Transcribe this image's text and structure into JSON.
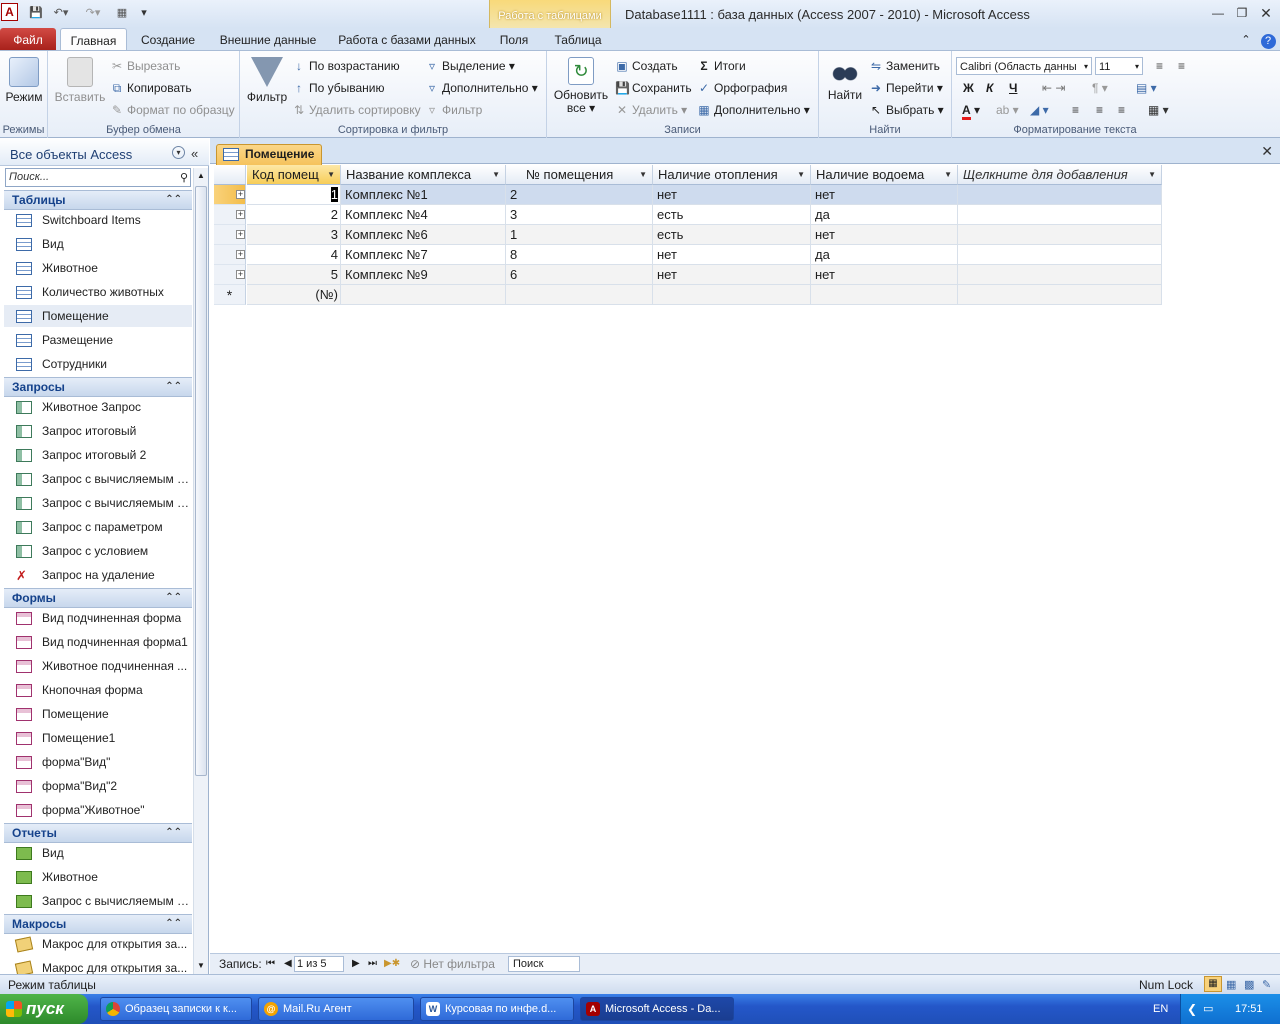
{
  "window": {
    "title": "Database1111 : база данных (Access 2007 - 2010)  -  Microsoft Access",
    "app_logo": "A",
    "contextual_group": "Работа с таблицами"
  },
  "tabs": [
    {
      "label": "Файл"
    },
    {
      "label": "Главная"
    },
    {
      "label": "Создание"
    },
    {
      "label": "Внешние данные"
    },
    {
      "label": "Работа с базами данных"
    },
    {
      "label": "Поля"
    },
    {
      "label": "Таблица"
    }
  ],
  "ribbon": {
    "groups": {
      "views": "Режимы",
      "clipboard": "Буфер обмена",
      "sort": "Сортировка и фильтр",
      "records": "Записи",
      "find": "Найти",
      "format": "Форматирование текста"
    },
    "view_btn": "Режим",
    "paste_btn": "Вставить",
    "cut": "Вырезать",
    "copy": "Копировать",
    "format_painter": "Формат по образцу",
    "filter_btn": "Фильтр",
    "asc": "По возрастанию",
    "desc": "По убыванию",
    "remove_sort": "Удалить сортировку",
    "selection": "Выделение",
    "advanced": "Дополнительно",
    "toggle_filter": "Фильтр",
    "refresh_btn": "Обновить все",
    "new": "Создать",
    "save": "Сохранить",
    "delete": "Удалить",
    "totals": "Итоги",
    "spelling": "Орфография",
    "more": "Дополнительно",
    "find_btn": "Найти",
    "replace": "Заменить",
    "goto": "Перейти",
    "select": "Выбрать",
    "font_name": "Calibri (Область данны",
    "font_size": "11",
    "bold": "Ж",
    "italic": "К",
    "underline": "Ч"
  },
  "nav": {
    "title": "Все объекты Access",
    "search_placeholder": "Поиск...",
    "sections": [
      {
        "label": "Таблицы",
        "items": [
          "Switchboard Items",
          "Вид",
          "Животное",
          "Количество животных",
          "Помещение",
          "Размещение",
          "Сотрудники"
        ]
      },
      {
        "label": "Запросы",
        "items": [
          "Животное Запрос",
          "Запрос итоговый",
          "Запрос итоговый 2",
          "Запрос с вычисляемым п...",
          "Запрос с вычисляемым п...",
          "Запрос с параметром",
          "Запрос с условием",
          "Запрос на удаление"
        ]
      },
      {
        "label": "Формы",
        "items": [
          "Вид подчиненная форма",
          "Вид подчиненная форма1",
          "Животное подчиненная ...",
          "Кнопочная форма",
          "Помещение",
          "Помещение1",
          "форма\"Вид\"",
          "форма\"Вид\"2",
          "форма\"Животное\""
        ]
      },
      {
        "label": "Отчеты",
        "items": [
          "Вид",
          "Животное",
          "Запрос с вычисляемым п..."
        ]
      },
      {
        "label": "Макросы",
        "items": [
          "Макрос для открытия за...",
          "Макрос для открытия за..."
        ]
      }
    ]
  },
  "document": {
    "tab_label": "Помещение",
    "columns": [
      "Код помещ",
      "Название комплекса",
      "№ помещения",
      "Наличие отопления",
      "Наличие водоема",
      "Щелкните для добавления"
    ],
    "rows": [
      [
        "1",
        "Комплекс №1",
        "2",
        "нет",
        "нет"
      ],
      [
        "2",
        "Комплекс №4",
        "3",
        "есть",
        "да"
      ],
      [
        "3",
        "Комплекс №6",
        "1",
        "есть",
        "нет"
      ],
      [
        "4",
        "Комплекс №7",
        "8",
        "нет",
        "да"
      ],
      [
        "5",
        "Комплекс №9",
        "6",
        "нет",
        "нет"
      ]
    ],
    "new_row_placeholder": "(№)",
    "new_row_marker": "*",
    "recnav": {
      "label": "Запись:",
      "position": "1 из 5",
      "filter": "Нет фильтра",
      "search": "Поиск"
    }
  },
  "status": {
    "mode": "Режим таблицы",
    "numlock": "Num Lock"
  },
  "taskbar": {
    "start": "пуск",
    "items": [
      {
        "label": "Образец записки к к..."
      },
      {
        "label": "Mail.Ru Агент"
      },
      {
        "label": "Курсовая по инфе.d..."
      },
      {
        "label": "Microsoft Access - Da..."
      }
    ],
    "lang": "EN",
    "clock": "17:51"
  }
}
